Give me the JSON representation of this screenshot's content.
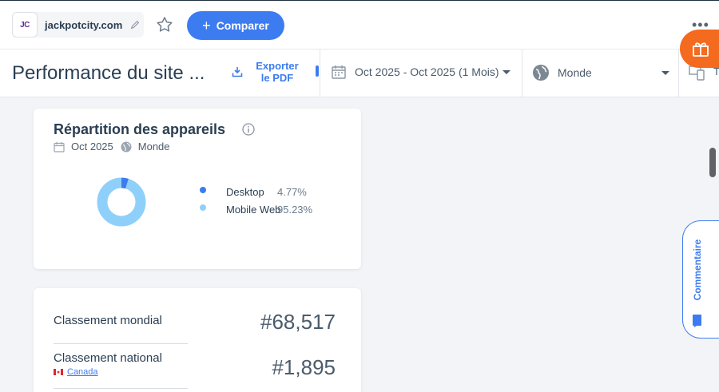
{
  "header": {
    "favicon_text": "JC",
    "domain": "jackpotcity.com",
    "compare_label": "Comparer"
  },
  "toolbar": {
    "page_title": "Performance du site ...",
    "export_line1": "Exporter",
    "export_line2": "le PDF",
    "date_range": "Oct 2025 - Oct 2025 (1 Mois)",
    "region": "Monde",
    "cut_label": "T"
  },
  "device_card": {
    "title": "Répartition des appareils",
    "period": "Oct 2025",
    "region": "Monde",
    "legend": [
      {
        "name": "Desktop",
        "value": "4.77%",
        "fraction": 0.0477,
        "color": "#3d7cf0"
      },
      {
        "name": "Mobile Web",
        "value": "95.23%",
        "fraction": 0.9523,
        "color": "#8fd0fa"
      }
    ]
  },
  "rank_card": {
    "global_label": "Classement mondial",
    "global_value": "#68,517",
    "national_label": "Classement national",
    "country": "Canada",
    "national_value": "#1,895"
  },
  "sidebar": {
    "comment_label": "Commentaire"
  },
  "colors": {
    "accent": "#3d7cf0",
    "gift": "#f46a1f",
    "desktop": "#3d7cf0",
    "mobile": "#8fd0fa"
  }
}
